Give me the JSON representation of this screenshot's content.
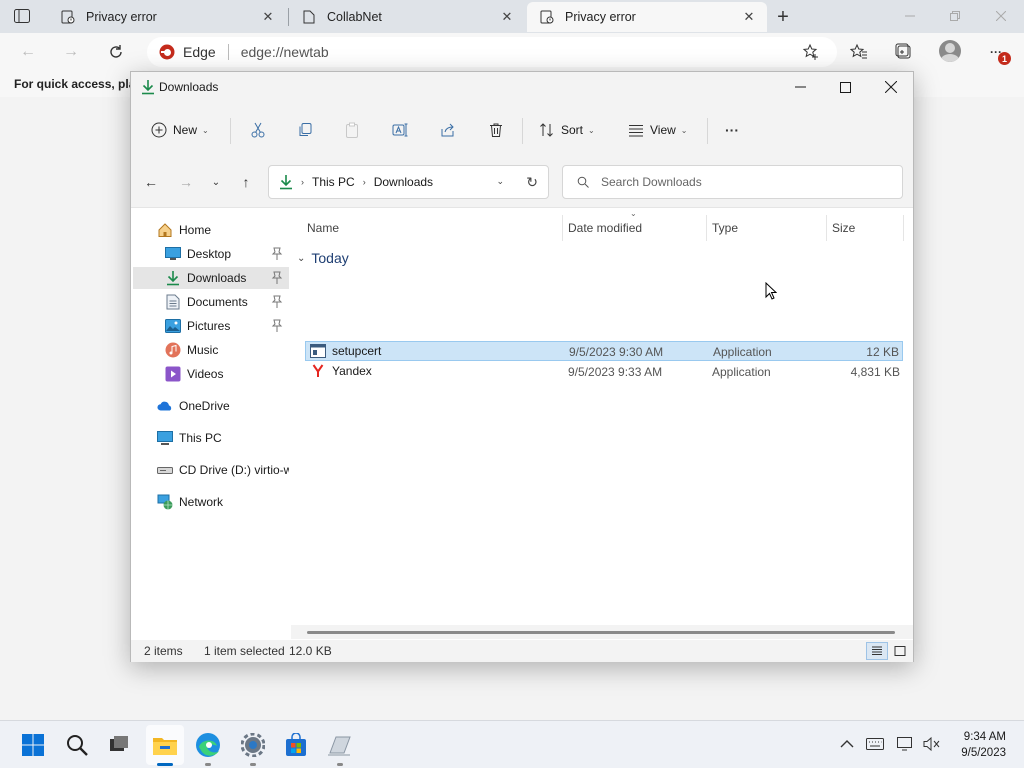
{
  "browser": {
    "tabs": [
      {
        "title": "Privacy error",
        "active": false
      },
      {
        "title": "CollabNet",
        "active": false
      },
      {
        "title": "Privacy error",
        "active": true
      }
    ],
    "omnibox": {
      "brand": "Edge",
      "url": "edge://newtab"
    },
    "favbar_text": "For quick access, plac",
    "notification_count": "1"
  },
  "explorer": {
    "title": "Downloads",
    "commands": {
      "new": "New",
      "sort": "Sort",
      "view": "View",
      "more": "···"
    },
    "breadcrumb": [
      "This PC",
      "Downloads"
    ],
    "search_placeholder": "Search Downloads",
    "sidebar": [
      {
        "label": "Home",
        "icon": "home-icon"
      },
      {
        "label": "Desktop",
        "icon": "desktop-icon",
        "pinned": true
      },
      {
        "label": "Downloads",
        "icon": "download-icon",
        "pinned": true,
        "selected": true
      },
      {
        "label": "Documents",
        "icon": "documents-icon",
        "pinned": true
      },
      {
        "label": "Pictures",
        "icon": "pictures-icon",
        "pinned": true
      },
      {
        "label": "Music",
        "icon": "music-icon"
      },
      {
        "label": "Videos",
        "icon": "videos-icon"
      },
      {
        "label": "OneDrive",
        "icon": "onedrive-icon"
      },
      {
        "label": "This PC",
        "icon": "pc-icon"
      },
      {
        "label": "CD Drive (D:) virtio-w",
        "icon": "cd-drive-icon"
      },
      {
        "label": "Network",
        "icon": "network-icon"
      }
    ],
    "columns": [
      "Name",
      "Date modified",
      "Type",
      "Size"
    ],
    "group": "Today",
    "files": [
      {
        "name": "setupcert",
        "date": "9/5/2023 9:30 AM",
        "type": "Application",
        "size": "12 KB",
        "selected": true
      },
      {
        "name": "Yandex",
        "date": "9/5/2023 9:33 AM",
        "type": "Application",
        "size": "4,831 KB",
        "selected": false
      }
    ],
    "status": {
      "count": "2 items",
      "selection": "1 item selected",
      "size": "12.0 KB"
    }
  },
  "taskbar": {
    "time": "9:34 AM",
    "date": "9/5/2023"
  },
  "colors": {
    "accent": "#0067c0",
    "selection": "#cce4f7",
    "edge_red": "#c42b1c"
  }
}
